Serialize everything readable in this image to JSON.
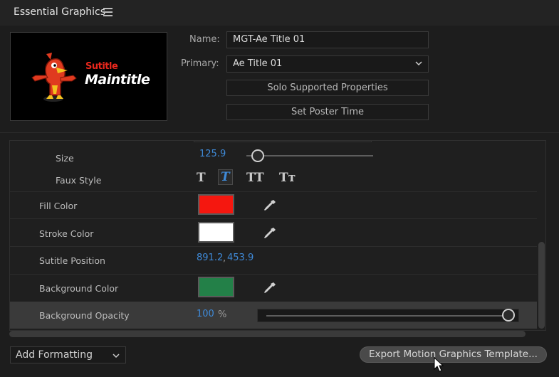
{
  "panel": {
    "title": "Essential Graphics",
    "menu_icon": "hamburger-menu-icon"
  },
  "thumbnail": {
    "line1": "Sutitle",
    "line2": "Maintitle"
  },
  "fields": {
    "name_label": "Name:",
    "name_value": "MGT-Ae Title 01",
    "primary_label": "Primary:",
    "primary_value": "Ae Title 01"
  },
  "buttons": {
    "solo": "Solo Supported Properties",
    "poster": "Set Poster Time",
    "export": "Export Motion Graphics Template..."
  },
  "properties": {
    "size_label": "Size",
    "size_value": "125.9",
    "size_slider_fraction": 0.09,
    "faux_label": "Faux Style",
    "faux_styles": [
      "T",
      "T",
      "TT",
      "Tт"
    ],
    "fill_label": "Fill Color",
    "fill_color": "#f5170f",
    "stroke_label": "Stroke Color",
    "stroke_color": "#ffffff",
    "position_label": "Sutitle Position",
    "position_x": "891.2",
    "position_sep": ",",
    "position_y": "453.9",
    "bg_color_label": "Background Color",
    "bg_color": "#238048",
    "bg_opacity_label": "Background Opacity",
    "bg_opacity_value": "100",
    "bg_opacity_unit": "%",
    "bg_opacity_fraction": 1.0
  },
  "footer": {
    "add_formatting": "Add Formatting"
  },
  "colors": {
    "accent_blue": "#3f8ad8",
    "panel_bg": "#1d1d1d"
  }
}
